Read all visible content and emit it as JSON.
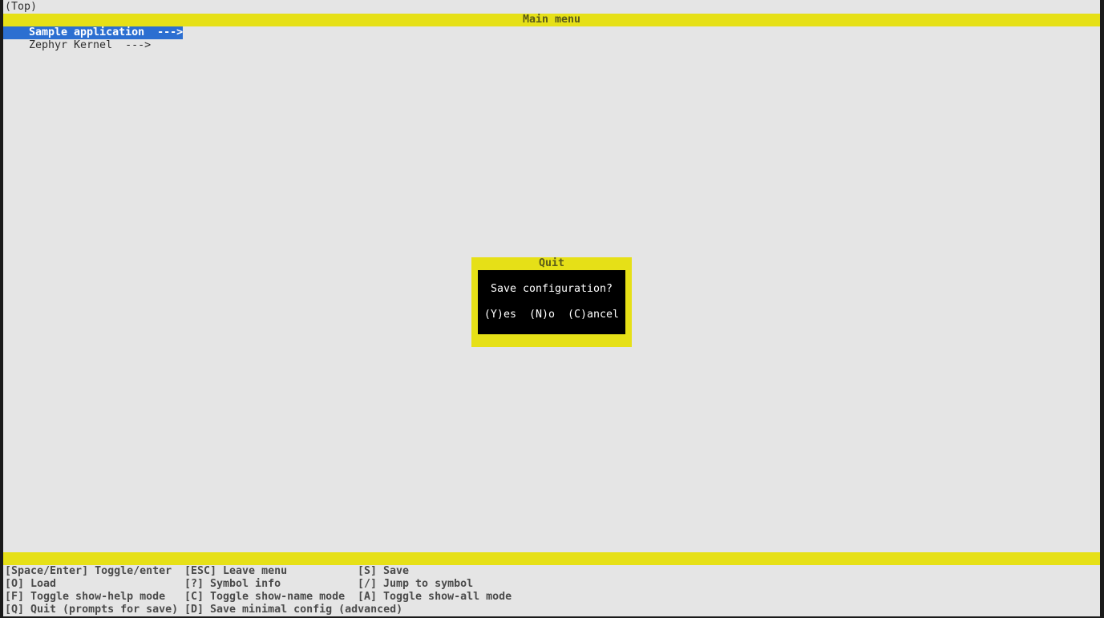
{
  "header": {
    "path": "(Top)",
    "title": "Main menu"
  },
  "menu": {
    "items": [
      {
        "label": "Sample application  --->",
        "selected": true
      },
      {
        "label": "Zephyr Kernel  --->",
        "selected": false
      }
    ]
  },
  "dialog": {
    "title": "Quit",
    "message": "Save configuration?",
    "yes": "(Y)es",
    "no": "(N)o",
    "cancel": "(C)ancel"
  },
  "help": {
    "rows": [
      [
        "[Space/Enter] Toggle/enter",
        "[ESC] Leave menu",
        "[S] Save"
      ],
      [
        "[O] Load",
        "[?] Symbol info",
        "[/] Jump to symbol"
      ],
      [
        "[F] Toggle show-help mode",
        "[C] Toggle show-name mode",
        "[A] Toggle show-all mode"
      ],
      [
        "[Q] Quit (prompts for save)",
        "[D] Save minimal config (advanced)",
        ""
      ]
    ]
  },
  "colors": {
    "background": "#e5e5e5",
    "bar": "#e6e017",
    "selection": "#2c6fd1",
    "dialog_body": "#000000"
  }
}
